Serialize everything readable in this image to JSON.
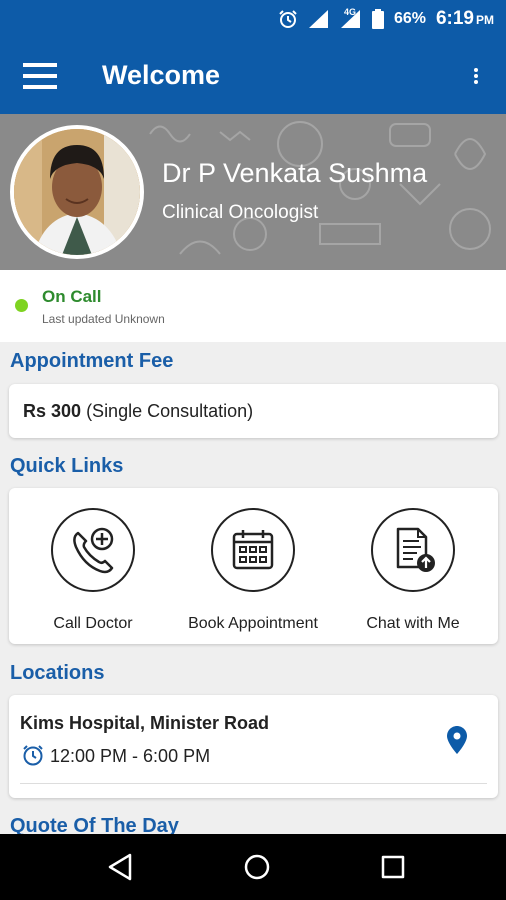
{
  "status_bar": {
    "battery": "66%",
    "time": "6:19",
    "period": "PM",
    "network": "4G"
  },
  "app_bar": {
    "title": "Welcome"
  },
  "doctor": {
    "name": "Dr P Venkata Sushma",
    "specialty": "Clinical Oncologist"
  },
  "call_status": {
    "label": "On Call",
    "updated": "Last updated Unknown",
    "dot_color": "#7ed321"
  },
  "fee": {
    "section_title": "Appointment Fee",
    "amount": "Rs 300",
    "note": "(Single Consultation)"
  },
  "quick_links": {
    "section_title": "Quick Links",
    "items": [
      {
        "label": "Call Doctor",
        "icon": "phone-plus-icon"
      },
      {
        "label": "Book Appointment",
        "icon": "calendar-icon"
      },
      {
        "label": "Chat with Me",
        "icon": "document-upload-icon"
      }
    ]
  },
  "locations": {
    "section_title": "Locations",
    "items": [
      {
        "name": "Kims Hospital, Minister Road",
        "hours": "12:00 PM - 6:00 PM"
      }
    ]
  },
  "quote": {
    "section_title": "Quote Of The Day"
  },
  "colors": {
    "primary": "#0d5ba8",
    "section_title": "#1a5ea8",
    "on_call": "#2e8b2e"
  }
}
